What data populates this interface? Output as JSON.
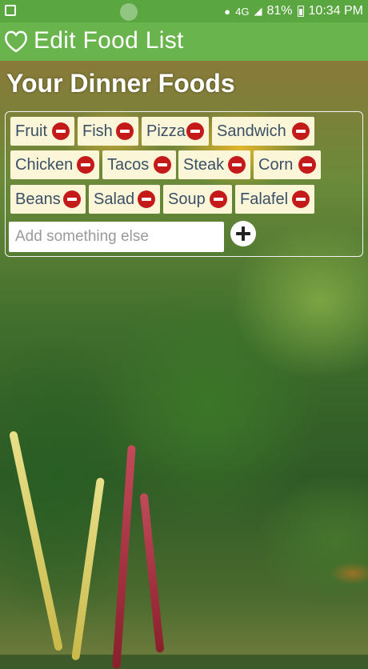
{
  "status_bar": {
    "network": "4G",
    "battery": "81%",
    "time": "10:34 PM"
  },
  "app_bar": {
    "title": "Edit Food List",
    "icon": "heart-outline-icon"
  },
  "section": {
    "title": "Your Dinner Foods"
  },
  "foods": [
    {
      "label": "Fruit"
    },
    {
      "label": "Fish"
    },
    {
      "label": "Pizza"
    },
    {
      "label": "Sandwich"
    },
    {
      "label": "Chicken"
    },
    {
      "label": "Tacos"
    },
    {
      "label": "Steak"
    },
    {
      "label": "Corn"
    },
    {
      "label": "Beans"
    },
    {
      "label": "Salad"
    },
    {
      "label": "Soup"
    },
    {
      "label": "Falafel"
    }
  ],
  "add_field": {
    "placeholder": "Add something else",
    "value": ""
  },
  "colors": {
    "status_bar": "#5aa640",
    "app_bar": "#69b44c",
    "chip_bg": "#fbf6d8",
    "chip_text": "#3b5066",
    "remove_icon": "#c41a1a"
  }
}
